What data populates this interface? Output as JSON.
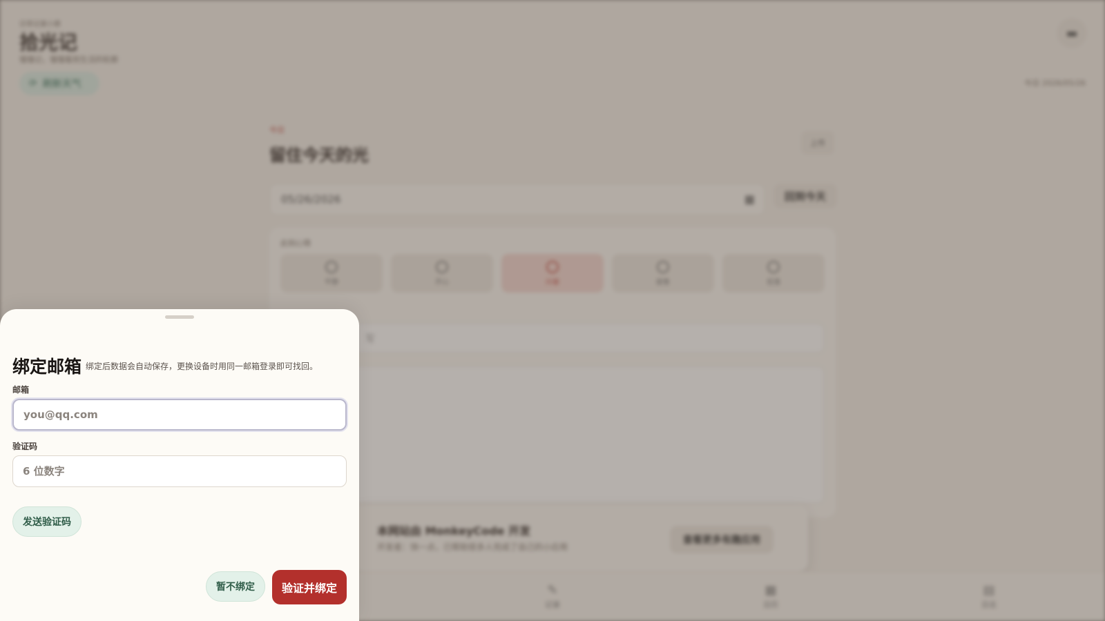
{
  "background": {
    "brand_small": "日常记录小册",
    "brand": "拾光记",
    "brand_sub": "慢慢记，慢慢看到生活的轮廓",
    "weather_label": "刷新天气",
    "weather_icon": "refresh-icon",
    "menu_icon": "menu-icon",
    "today_label": "今日 2026/05/26",
    "card_kicker": "今日",
    "card_title": "留住今天的光",
    "card_btn": "上传",
    "date_value": "05/26/2026",
    "date_icon": "calendar-icon",
    "today_btn": "回到今天",
    "mood_label": "此刻心情",
    "moods": [
      "平静",
      "开心",
      "兴奋",
      "疲惫",
      "低落"
    ],
    "active_mood_index": 2,
    "input_placeholder": "写",
    "promo_title": "本网站由 MonkeyCode 开发",
    "promo_sub": "开发者：快一点，已帮助很多人完成了自己的小应用",
    "promo_btn": "查看更多有趣应用",
    "tabs": [
      {
        "label": "记录",
        "icon": "pen-icon"
      },
      {
        "label": "日历",
        "icon": "calendar-icon"
      },
      {
        "label": "日志",
        "icon": "document-icon"
      }
    ]
  },
  "sheet": {
    "title": "绑定邮箱",
    "description": "绑定后数据会自动保存，更换设备时用同一邮箱登录即可找回。",
    "email_label": "邮箱",
    "email_placeholder": "you@qq.com",
    "email_value": "",
    "code_label": "验证码",
    "code_placeholder": "6 位数字",
    "code_value": "",
    "send_code_label": "发送验证码",
    "skip_label": "暂不绑定",
    "confirm_label": "验证并绑定"
  },
  "colors": {
    "primary": "#b3302c",
    "accent_green": "#e3f1e9",
    "sheet_bg": "#fdfbf6"
  }
}
